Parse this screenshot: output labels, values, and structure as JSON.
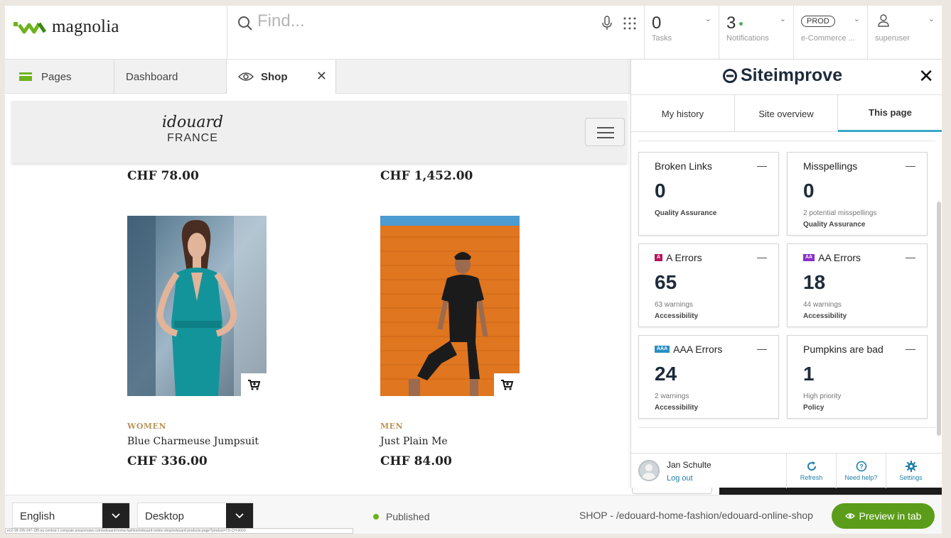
{
  "app": {
    "logo_text": "magnolia",
    "search_placeholder": "Find...",
    "tasks": {
      "count": "0",
      "label": "Tasks"
    },
    "notifications": {
      "count": "3",
      "label": "Notifications"
    },
    "environment": {
      "badge": "PROD",
      "label": "e-Commerce ..."
    },
    "user": {
      "label": "superuser"
    }
  },
  "tabs": [
    {
      "label": "Pages"
    },
    {
      "label": "Dashboard"
    },
    {
      "label": "Shop"
    }
  ],
  "site": {
    "brand_script": "idouard",
    "brand_sub": "FRANCE",
    "prev_prices": [
      "CHF 78.00",
      "CHF 1,452.00"
    ],
    "products": [
      {
        "category": "WOMEN",
        "name": "Blue Charmeuse Jumpsuit",
        "price": "CHF 336.00"
      },
      {
        "category": "MEN",
        "name": "Just Plain Me",
        "price": "CHF 84.00"
      }
    ]
  },
  "panel": {
    "title": "Siteimprove",
    "tabs": [
      "My history",
      "Site overview",
      "This page"
    ],
    "cards": [
      {
        "title": "Broken Links",
        "value": "0",
        "sub": "",
        "category": "Quality Assurance"
      },
      {
        "title": "Misspellings",
        "value": "0",
        "sub": "2 potential misspellings",
        "category": "Quality Assurance"
      },
      {
        "title": "A Errors",
        "badge": "A",
        "value": "65",
        "sub": "63 warnings",
        "category": "Accessibility"
      },
      {
        "title": "AA Errors",
        "badge": "AA",
        "value": "18",
        "sub": "44 warnings",
        "category": "Accessibility"
      },
      {
        "title": "AAA Errors",
        "badge": "AAA",
        "value": "24",
        "sub": "2 warnings",
        "category": "Accessibility"
      },
      {
        "title": "Pumpkins are bad",
        "value": "1",
        "sub": "High priority",
        "category": "Policy"
      }
    ],
    "user_name": "Jan Schulte",
    "logout": "Log out",
    "footer_buttons": [
      "Refresh",
      "Need help?",
      "Settings"
    ]
  },
  "footer": {
    "language": "English",
    "device": "Desktop",
    "status": "Published",
    "path": "SHOP - /edouard-home-fashion/edouard-online-shop",
    "preview": "Preview in tab",
    "url": "ec2-18-195-247-185.eu-central-1.compute.amazonaws.com/edouard-home-fashion/edouard-online-shop/edouard-products-page?product=TS-CH-0003"
  },
  "colors": {
    "accent_green": "#5b9d1b",
    "siteimprove_blue": "#3aa7c9",
    "badge_a": "#b5175e",
    "badge_aa": "#8b2fc9",
    "badge_aaa": "#2a8fc1"
  }
}
